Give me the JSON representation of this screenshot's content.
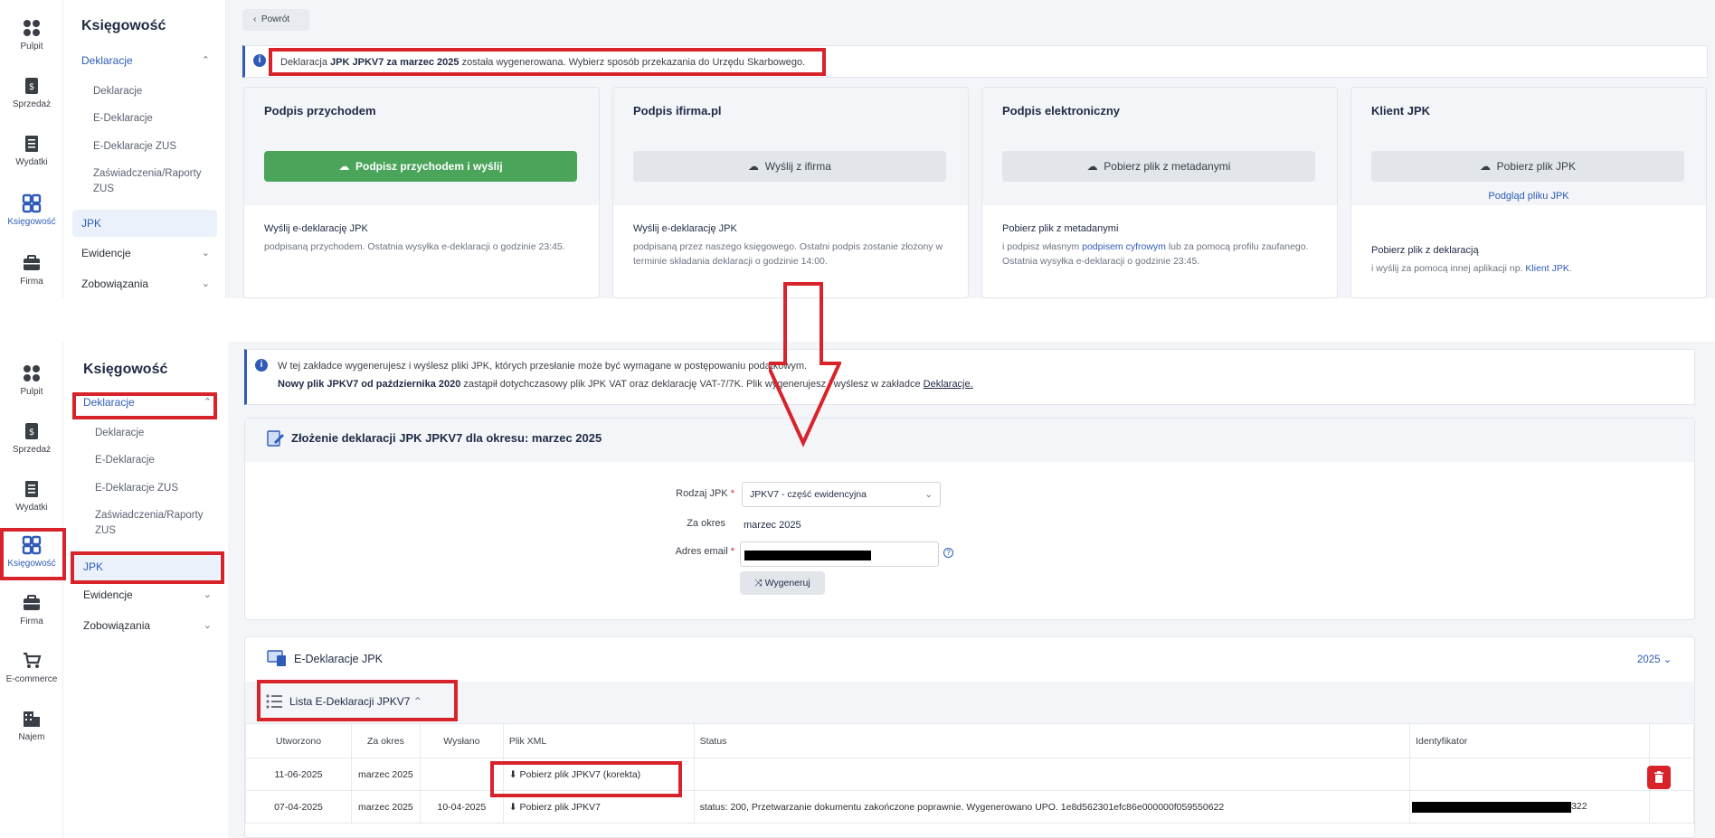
{
  "rail": {
    "items": [
      {
        "label": "Pulpit",
        "icon": "dashboard-icon"
      },
      {
        "label": "Sprzedaż",
        "icon": "sales-document-icon"
      },
      {
        "label": "Wydatki",
        "icon": "expenses-receipt-icon"
      },
      {
        "label": "Księgowość",
        "icon": "accounting-grid-icon"
      },
      {
        "label": "Firma",
        "icon": "briefcase-icon"
      },
      {
        "label": "E-commerce",
        "icon": "cart-icon"
      },
      {
        "label": "Najem",
        "icon": "building-icon"
      }
    ]
  },
  "sidebar": {
    "title": "Księgowość",
    "deklaracje": "Deklaracje",
    "sub_items": [
      "Deklaracje",
      "E-Deklaracje",
      "E-Deklaracje ZUS",
      "Zaświadczenia/Raporty ZUS"
    ],
    "jpk": "JPK",
    "ewidencje": "Ewidencje",
    "zobowiazania": "Zobowiązania"
  },
  "top": {
    "back_button": "Powrót",
    "info": {
      "prefix": "Deklaracja ",
      "bold": "JPK JPKV7 za marzec 2025",
      "suffix": " została wygenerowana. Wybierz sposób przekazania do Urzędu Skarbowego."
    },
    "cards": [
      {
        "title": "Podpis przychodem",
        "button": "Podpisz przychodem i wyślij",
        "link": "",
        "body_title": "Wyślij e-deklarację JPK",
        "desc": "podpisaną przychodem. Ostatnia wysyłka e-deklaracji o godzinie 23:45."
      },
      {
        "title": "Podpis ifirma.pl",
        "button": "Wyślij z ifirma",
        "link": "",
        "body_title": "Wyślij e-deklarację JPK",
        "desc": "podpisaną przez naszego księgowego. Ostatni podpis zostanie złożony w terminie składania deklaracji o godzinie 14:00."
      },
      {
        "title": "Podpis elektroniczny",
        "button": "Pobierz plik z metadanymi",
        "link": "",
        "body_title": "Pobierz plik z metadanymi",
        "desc_pre": "i podpisz własnym ",
        "desc_link": "podpisem cyfrowym",
        "desc_post": " lub za pomocą profilu zaufanego. Ostatnia wysyłka e-deklaracji o godzinie 23:45."
      },
      {
        "title": "Klient JPK",
        "button": "Pobierz plik JPK",
        "link": "Podgląd pliku JPK",
        "body_title": "Pobierz plik z deklaracją",
        "desc_pre": "i wyślij za pomocą innej aplikacji np. ",
        "desc_link": "Klient JPK",
        "desc_post": "."
      }
    ]
  },
  "bottom": {
    "info_line1": "W tej zakładce wygenerujesz i wyślesz pliki JPK, których przesłanie może być wymagane w postępowaniu podatkowym.",
    "info_line2_bold": "Nowy plik JPKV7 od października 2020",
    "info_line2_mid": " zastąpił dotychczasowy plik JPK VAT oraz deklarację VAT-7/7K. Plik wygenerujesz i wyślesz w zakładce ",
    "info_line2_link": "Deklaracje.",
    "form_title": "Złożenie deklaracji JPK JPKV7 dla okresu: marzec 2025",
    "rodzaj_label": "Rodzaj JPK",
    "rodzaj_value": "JPKV7 - część ewidencyjna",
    "okres_label": "Za okres",
    "okres_value": "marzec 2025",
    "email_label": "Adres email",
    "generate_button": "Wygeneruj",
    "edekl_title": "E-Deklaracje JPK",
    "year": "2025",
    "list_title": "Lista E-Deklaracji JPKV7",
    "columns": [
      "Utworzono",
      "Za okres",
      "Wysłano",
      "Plik XML",
      "Status",
      "Identyfikator"
    ],
    "rows": [
      {
        "created": "11-06-2025",
        "period": "marzec 2025",
        "sent": "",
        "xml": "Pobierz plik JPKV7 (korekta)",
        "status": "",
        "id": ""
      },
      {
        "created": "07-04-2025",
        "period": "marzec 2025",
        "sent": "10-04-2025",
        "xml": "Pobierz plik JPKV7",
        "status": "status: 200, Przetwarzanie dokumentu zakończone poprawnie. Wygenerowano UPO. 1e8d562301efc86e000000f059550622",
        "id": "322"
      }
    ]
  },
  "colors": {
    "accent": "#2f5bb7",
    "green": "#4aa55a",
    "highlight": "#d8232a"
  }
}
